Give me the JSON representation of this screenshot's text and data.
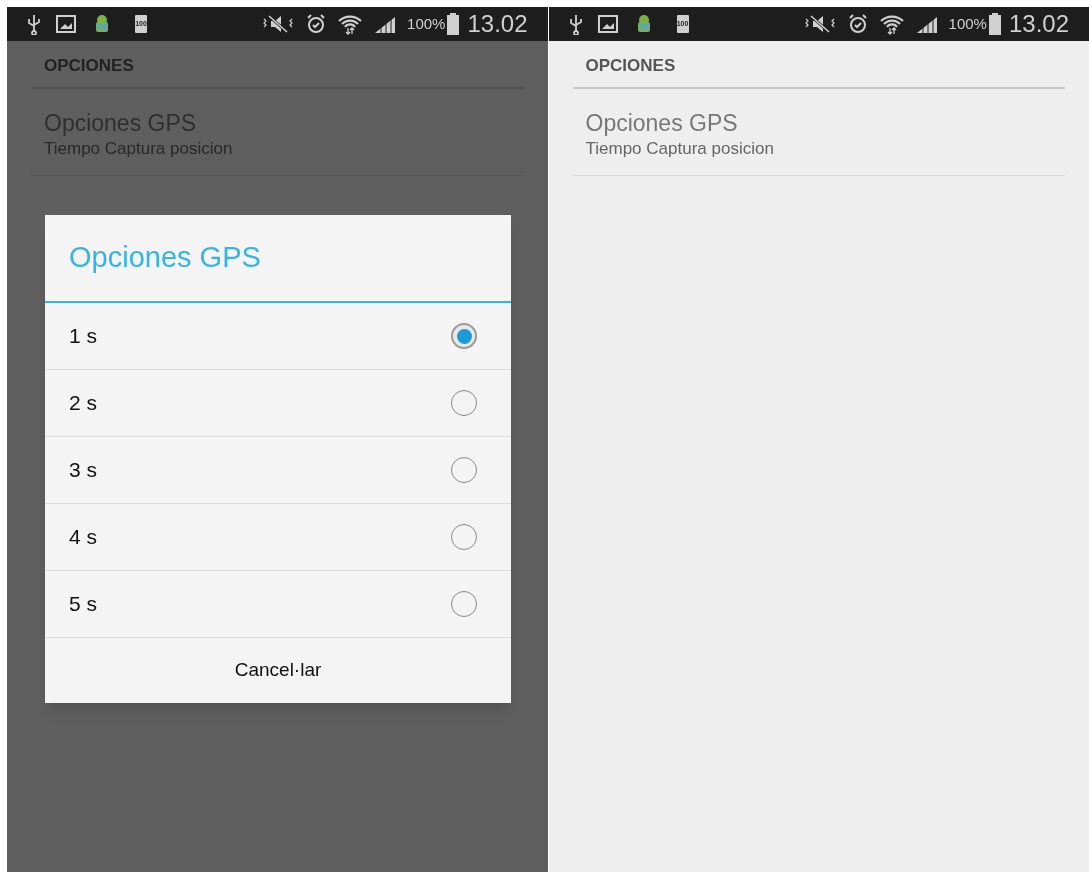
{
  "screens": [
    {
      "status_bar": {
        "badge": "100",
        "battery_percent": "100%",
        "time": "13.02"
      },
      "section_header": "OPCIONES",
      "preference": {
        "title": "Opciones GPS",
        "summary": "Tiempo Captura posicion"
      },
      "dialog": {
        "title": "Opciones GPS",
        "options": [
          {
            "label": "1 s",
            "selected": true
          },
          {
            "label": "2 s",
            "selected": false
          },
          {
            "label": "3 s",
            "selected": false
          },
          {
            "label": "4 s",
            "selected": false
          },
          {
            "label": "5 s",
            "selected": false
          }
        ],
        "cancel": "Cancel·lar"
      }
    },
    {
      "status_bar": {
        "badge": "100",
        "battery_percent": "100%",
        "time": "13.02"
      },
      "section_header": "OPCIONES",
      "preference": {
        "title": "Opciones GPS",
        "summary": "Tiempo Captura posicion"
      }
    }
  ]
}
